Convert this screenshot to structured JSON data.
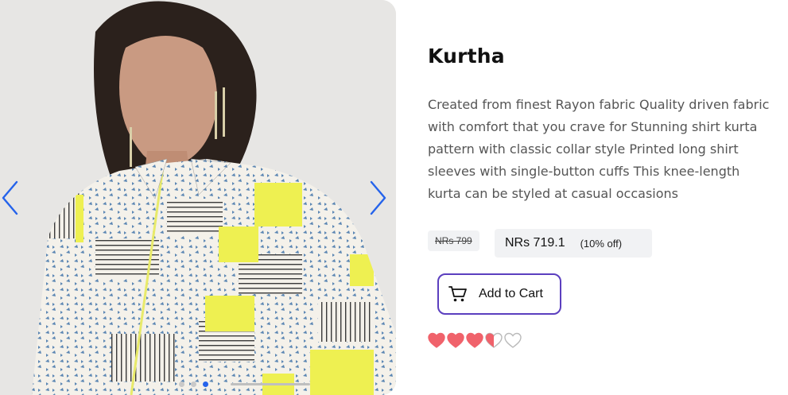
{
  "product": {
    "title": "Kurtha",
    "description": "Created from finest Rayon fabric Quality driven fabric with comfort that you crave for Stunning shirt kurta pattern with classic collar style Printed long shirt sleeves with single-button cuffs This knee-length kurta can be styled at casual occasions",
    "original_price": "NRs 799",
    "price": "NRs 719.1",
    "discount": "(10% off)",
    "add_to_cart_label": "Add to Cart",
    "rating": 3.5,
    "rating_max": 5
  },
  "carousel": {
    "total_slides": 3,
    "active_slide": 3,
    "prev_icon": "chevron-left-icon",
    "next_icon": "chevron-right-icon"
  },
  "colors": {
    "accent": "#2563eb",
    "button_border": "#5b3fbf",
    "heart_fill": "#f0626b"
  }
}
